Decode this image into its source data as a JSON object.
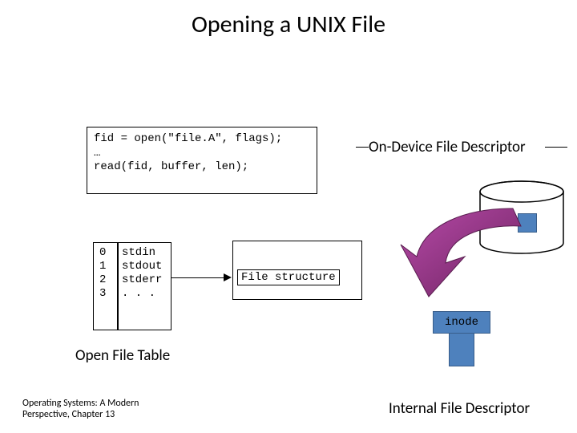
{
  "title": "Opening a UNIX File",
  "code": {
    "line1": "fid = open(\"file.A\", flags);",
    "line2": "…",
    "line3": "read(fid, buffer, len);"
  },
  "ondevice_label": "On-Device File Descriptor",
  "open_file_table": {
    "label": "Open File Table",
    "rows": [
      {
        "idx": "0",
        "name": "stdin"
      },
      {
        "idx": "1",
        "name": "stdout"
      },
      {
        "idx": "2",
        "name": "stderr"
      },
      {
        "idx": "3",
        "name": ". . ."
      }
    ]
  },
  "file_structure_label": "File structure",
  "inode_label": "inode",
  "internal_fd_label": "Internal File Descriptor",
  "footer": {
    "l1": "Operating Systems: A Modern",
    "l2": "Perspective, Chapter 13"
  },
  "colors": {
    "blue_fill": "#4e81bd",
    "blue_border": "#385d8a",
    "purple": "#8a2e7a"
  }
}
